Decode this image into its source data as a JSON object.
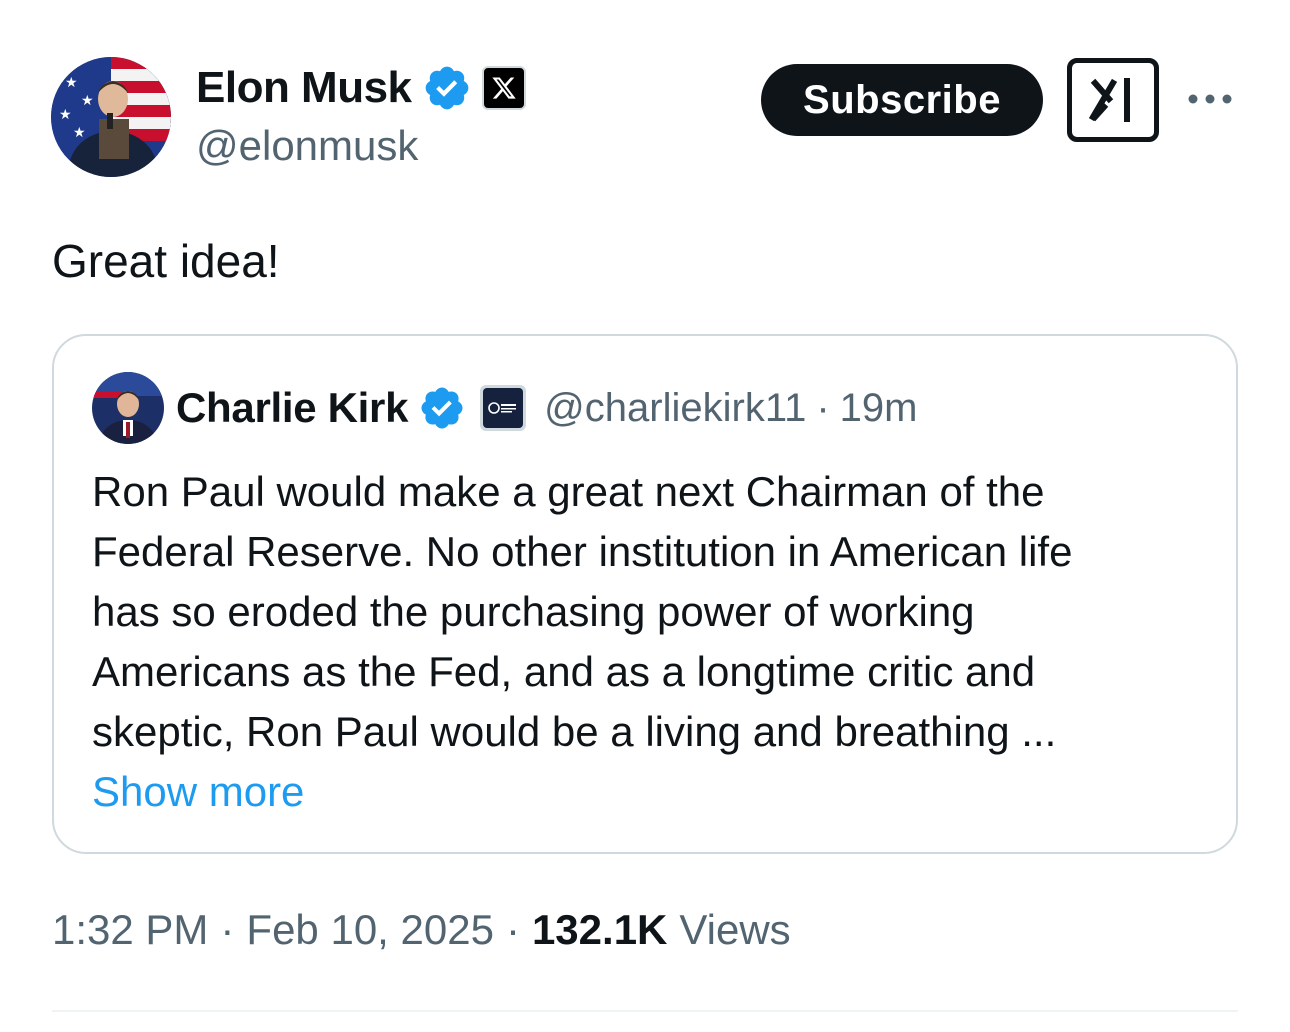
{
  "author": {
    "name": "Elon Musk",
    "handle": "@elonmusk"
  },
  "actions": {
    "subscribe_label": "Subscribe"
  },
  "tweet": {
    "text": "Great idea!"
  },
  "quote": {
    "name": "Charlie Kirk",
    "handle": "@charliekirk11",
    "separator": "·",
    "time": "19m",
    "body_lines": [
      "Ron Paul would make a great next Chairman of the",
      "Federal Reserve. No other institution in American life",
      "has so eroded the purchasing power of working",
      "Americans as the Fed, and as a longtime critic and",
      "skeptic, Ron Paul would be a living and breathing ..."
    ],
    "show_more": "Show more"
  },
  "meta": {
    "time": "1:32 PM",
    "sep1": "·",
    "date": "Feb 10, 2025",
    "sep2": "·",
    "views_count": "132.1K",
    "views_label": "Views"
  },
  "icons": {
    "verified": "verified-badge-icon",
    "x_logo": "x-logo-icon",
    "grok": "grok-icon",
    "more": "more-dots-icon",
    "tpusa": "affiliate-badge-icon"
  },
  "colors": {
    "text_primary": "#0f1419",
    "text_secondary": "#536471",
    "link": "#1d9bf0",
    "verified": "#1d9bf0",
    "border": "#cfd9de"
  }
}
